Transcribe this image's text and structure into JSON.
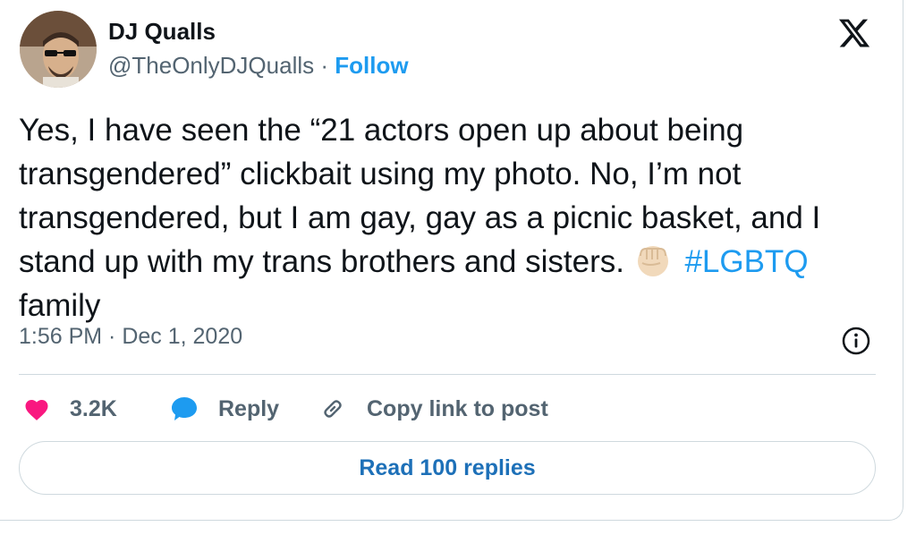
{
  "author": {
    "name": "DJ Qualls",
    "handle": "@TheOnlyDJQualls",
    "separator": "·",
    "follow_label": "Follow"
  },
  "tweet": {
    "text_lines": [
      "Yes, I have seen the “21 actors open up about being",
      "transgendered” clickbait using my photo. No, I’m not",
      "transgendered, but I am gay, gay as a picnic basket, and I",
      "stand up with my trans brothers and sisters."
    ],
    "emoji": "raised-fist-light-skin",
    "hashtag": "#LGBTQ",
    "text_tail": "family"
  },
  "meta": {
    "timestamp": "1:56 PM · Dec 1, 2020"
  },
  "actions": {
    "like_count": "3.2K",
    "reply_label": "Reply",
    "copy_label": "Copy link to post"
  },
  "read_replies_label": "Read 100 replies",
  "icons": {
    "logo": "x-logo-icon",
    "info": "info-icon",
    "heart": "heart-icon",
    "reply": "reply-bubble-icon",
    "link": "link-icon"
  },
  "colors": {
    "accent": "#1d9bf0",
    "heart": "#f91880",
    "text": "#0f1419",
    "secondary": "#536471",
    "border": "#cfd9de"
  }
}
